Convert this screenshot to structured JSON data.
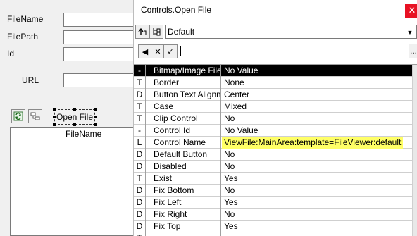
{
  "form": {
    "fields": [
      {
        "label": "FileName"
      },
      {
        "label": "FilePath"
      },
      {
        "label": "Id"
      }
    ],
    "url_label": "URL",
    "open_file_button": "Open File",
    "grid": {
      "column_header": "FileName"
    }
  },
  "window": {
    "title": "Controls.Open File",
    "close_glyph": "✕",
    "layout_combo": {
      "value": "Default"
    },
    "toolbar": {
      "up_icon": "up-arrow-icon",
      "tree_icon": "tree-icon",
      "prev_glyph": "◀",
      "cancel_glyph": "✕",
      "accept_glyph": "✓",
      "ellipsis": "..."
    },
    "properties": [
      {
        "cat": "-",
        "name": "Bitmap/Image File",
        "value": "No Value",
        "selected": true
      },
      {
        "cat": "T",
        "name": "Border",
        "value": "None"
      },
      {
        "cat": "D",
        "name": "Button Text Alignm",
        "value": "Center"
      },
      {
        "cat": "T",
        "name": "Case",
        "value": "Mixed"
      },
      {
        "cat": "T",
        "name": "Clip Control",
        "value": "No"
      },
      {
        "cat": "-",
        "name": "Control Id",
        "value": "No Value"
      },
      {
        "cat": "L",
        "name": "Control Name",
        "value": "ViewFile:MainArea:template=FileViewer:default",
        "highlight": true
      },
      {
        "cat": "D",
        "name": "Default Button",
        "value": "No"
      },
      {
        "cat": "D",
        "name": "Disabled",
        "value": "No"
      },
      {
        "cat": "T",
        "name": "Exist",
        "value": "Yes"
      },
      {
        "cat": "D",
        "name": "Fix Bottom",
        "value": "No"
      },
      {
        "cat": "D",
        "name": "Fix Left",
        "value": "Yes"
      },
      {
        "cat": "D",
        "name": "Fix Right",
        "value": "No"
      },
      {
        "cat": "D",
        "name": "Fix Top",
        "value": "Yes"
      },
      {
        "cat": "T",
        "name": "",
        "value": ""
      }
    ]
  },
  "colors": {
    "highlight": "#ffff66",
    "close_button": "#e81123",
    "selected_row": "#000000"
  }
}
